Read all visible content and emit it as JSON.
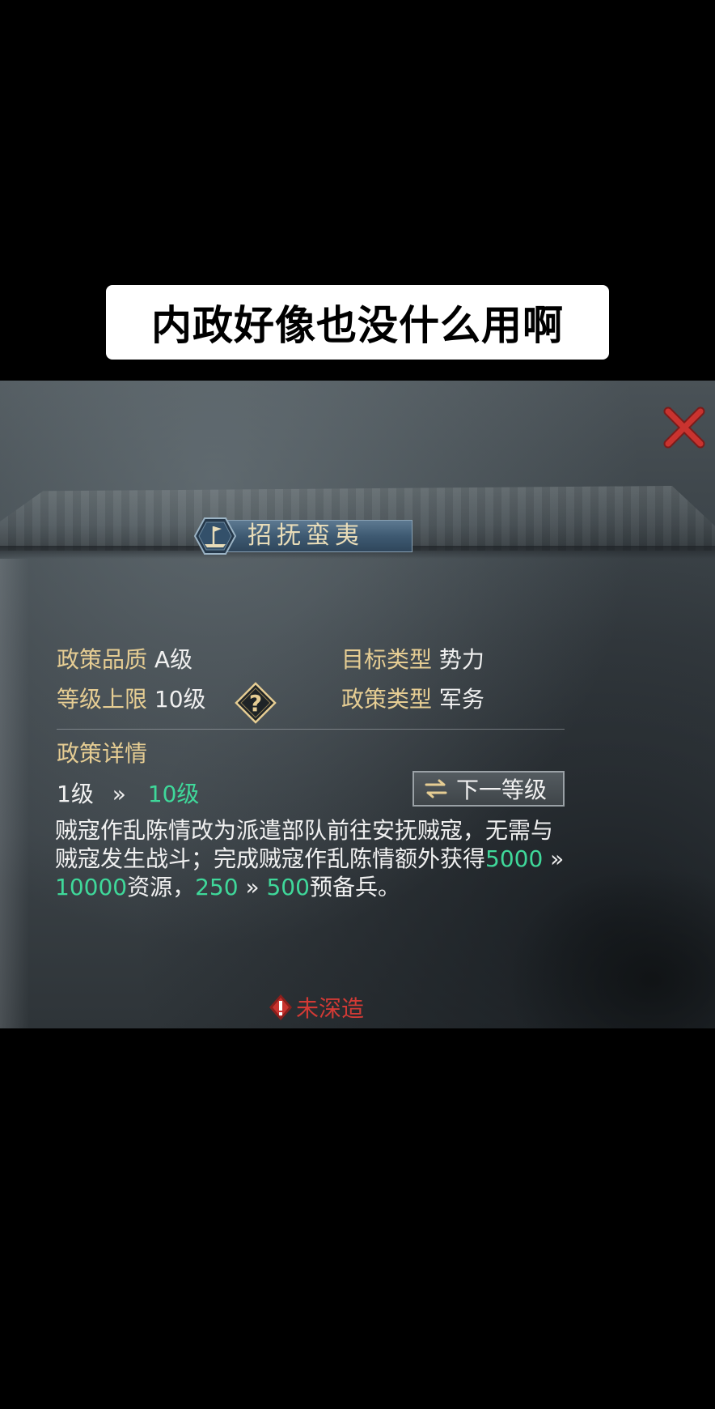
{
  "caption": {
    "text": "内政好像也没什么用啊"
  },
  "policy": {
    "name": "招抚蛮夷",
    "quality_label": "政策品质",
    "quality_value": "A级",
    "target_type_label": "目标类型",
    "target_type_value": "势力",
    "level_cap_label": "等级上限",
    "level_cap_value": "10级",
    "policy_type_label": "政策类型",
    "policy_type_value": "军务",
    "details_label": "政策详情",
    "level_from": "1级",
    "level_sep": "»",
    "level_to": "10级",
    "next_level_button": "下一等级",
    "desc_part1": "贼寇作乱陈情改为派遣部队前往安抚贼寇，无需与贼寇发生战斗；完成贼寇作乱陈情额外获得",
    "desc_num1": "5000",
    "desc_sep1": " » ",
    "desc_num2": "10000",
    "desc_part2": "资源，",
    "desc_num3": "250",
    "desc_sep2": " » ",
    "desc_num4": "500",
    "desc_part3": "预备兵。",
    "status_text": "未深造"
  },
  "colors": {
    "label_gold": "#e6cd93",
    "value_green": "#3fd89a",
    "status_red": "#d23a35",
    "close_red": "#c9332f"
  },
  "icons": {
    "close": "close-icon",
    "title": "flag-hex-icon",
    "help": "question-diamond-icon",
    "next": "swap-arrows-icon",
    "warning": "warning-icon"
  }
}
